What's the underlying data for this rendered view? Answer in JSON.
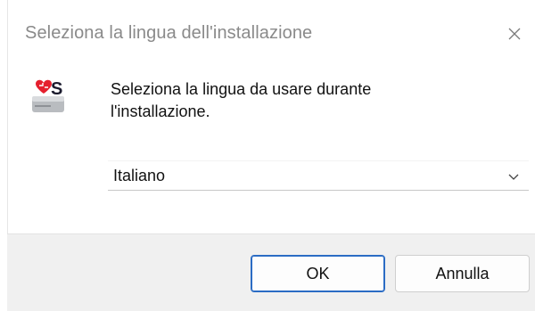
{
  "window": {
    "title": "Seleziona la lingua dell'installazione"
  },
  "content": {
    "prompt_line1": "Seleziona la lingua da usare durante",
    "prompt_line2": "l'installazione.",
    "app_icon": "setup-app-icon"
  },
  "language_select": {
    "selected": "Italiano",
    "icon": "chevron-down-icon"
  },
  "buttons": {
    "ok_label": "OK",
    "cancel_label": "Annulla"
  },
  "colors": {
    "accent": "#2b6cc4",
    "icon_red": "#e5202e",
    "footer_bg": "#f0f0f0",
    "title_text": "#8a8a8a"
  }
}
